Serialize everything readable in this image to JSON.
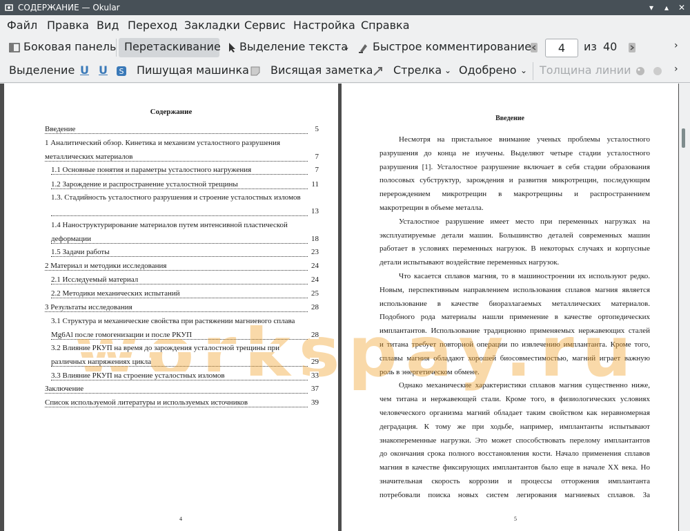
{
  "window": {
    "title": "СОДЕРЖАНИЕ  — Okular"
  },
  "menu": [
    "Файл",
    "Правка",
    "Вид",
    "Переход",
    "Закладки",
    "Сервис",
    "Настройка",
    "Справка"
  ],
  "toolbar1": {
    "sidebar": "Боковая панель",
    "drag": "Перетаскивание",
    "text_select": "Выделение текста",
    "quick_comment": "Быстрое комментирование",
    "page_current": "4",
    "of": "из",
    "page_total": "40"
  },
  "toolbar2": {
    "selection": "Выделение",
    "typewriter": "Пишущая машинка",
    "sticky_note": "Висящая заметка",
    "arrow": "Стрелка",
    "approved": "Одобрено",
    "line_width": "Толщина линии"
  },
  "left_page": {
    "title": "Содержание",
    "toc": [
      {
        "text": "Введение",
        "page": "5"
      },
      {
        "text": "1 Аналитический обзор. Кинетика и механизм усталостного разрушения",
        "page": ""
      },
      {
        "text": "металлических материалов",
        "page": "7"
      },
      {
        "text": "1.1  Основные понятия и параметры усталостного нагружения",
        "page": "7"
      },
      {
        "text": "1.2 Зарождение и распространение усталостной трещины",
        "page": "11"
      },
      {
        "text": "1.3. Стадийность усталостного разрушения и строение усталостных изломов",
        "page": ""
      },
      {
        "text": "",
        "page": "13"
      },
      {
        "text": "1.4 Наноструктурирование материалов путем интенсивной пластической",
        "page": ""
      },
      {
        "text": "деформации",
        "page": "18"
      },
      {
        "text": "1.5 Задачи работы",
        "page": "23"
      },
      {
        "text": "2 Материал и методики исследования",
        "page": "24"
      },
      {
        "text": "2.1 Исследуемый материал",
        "page": "24"
      },
      {
        "text": "2.2 Методики механических испытаний",
        "page": "25"
      },
      {
        "text": "3 Результаты исследования",
        "page": "28"
      },
      {
        "text": "3.1 Структура и механические свойства при растяжении магниевого сплава",
        "page": ""
      },
      {
        "text": "Mg6Al после гомогенизации и после РКУП",
        "page": "28"
      },
      {
        "text": "3.2 Влияние РКУП на время до зарождения усталостной трещины при",
        "page": ""
      },
      {
        "text": "различных напряжениях цикла",
        "page": "29"
      },
      {
        "text": "3.3 Влияние РКУП на строение усталостных изломов",
        "page": "33"
      },
      {
        "text": "Заключение",
        "page": "37"
      },
      {
        "text": "Список используемой литературы и используемых источников",
        "page": "39"
      }
    ],
    "page_number": "4"
  },
  "right_page": {
    "title": "Введение",
    "lines": [
      "Несмотря на пристальное внимание ученых проблемы усталостного",
      "разрушения до конца не изучены. Выделяют четыре стадии усталостного",
      "разрушения [1]. Усталостное разрушение включает в себя стадии образования",
      "полосовых субструктур, зарождения и развития микротрещин, последующим",
      "перерождением микротрещин в макротрещины и распространением",
      "макротрещин в объеме металла.",
      "Усталостное разрушение имеет место при переменных нагрузках на",
      "эксплуатируемые детали машин. Большинство деталей современных машин",
      "работает в условиях переменных нагрузок. В некоторых случаях и корпусные",
      "детали испытывают воздействие переменных нагрузок.",
      "Что касается сплавов магния, то в машиностроении их используют редко.",
      "Новым, перспективным направлением использования сплавов магния является",
      "использование в качестве биоразлагаемых металлических материалов.",
      "Подобного рода материалы нашли применение в качестве ортопедических",
      "имплантантов. Использование традиционно применяемых нержавеющих сталей",
      "и титана требует повторной операции по извлечению имплантанта. Кроме того,",
      "сплавы магния обладают хорошей биосовместимостью, магний играет важную",
      "роль в энергетическом обмене.",
      "Однако механические характеристики сплавов магния существенно ниже,",
      "чем титана и нержавеющей стали. Кроме того, в физиологических условиях",
      "человеческого организма магний обладает таким свойством как неравномерная",
      "деградация. К тому же при ходьбе, например, имплантанты испытывают",
      "знакопеременные нагрузки. Это может способствовать перелому имплантантов",
      "до окончания срока полного восстановления кости. Начало применения сплавов",
      "магния в качестве фиксирующих имплантантов было еще в начале XX века. Но",
      "значительная скорость коррозии и процессы отторжения имплантанта",
      "потребовали поиска новых систем легирования магниевых сплавов. За"
    ],
    "page_number": "5"
  },
  "watermark": "workspay.ru"
}
